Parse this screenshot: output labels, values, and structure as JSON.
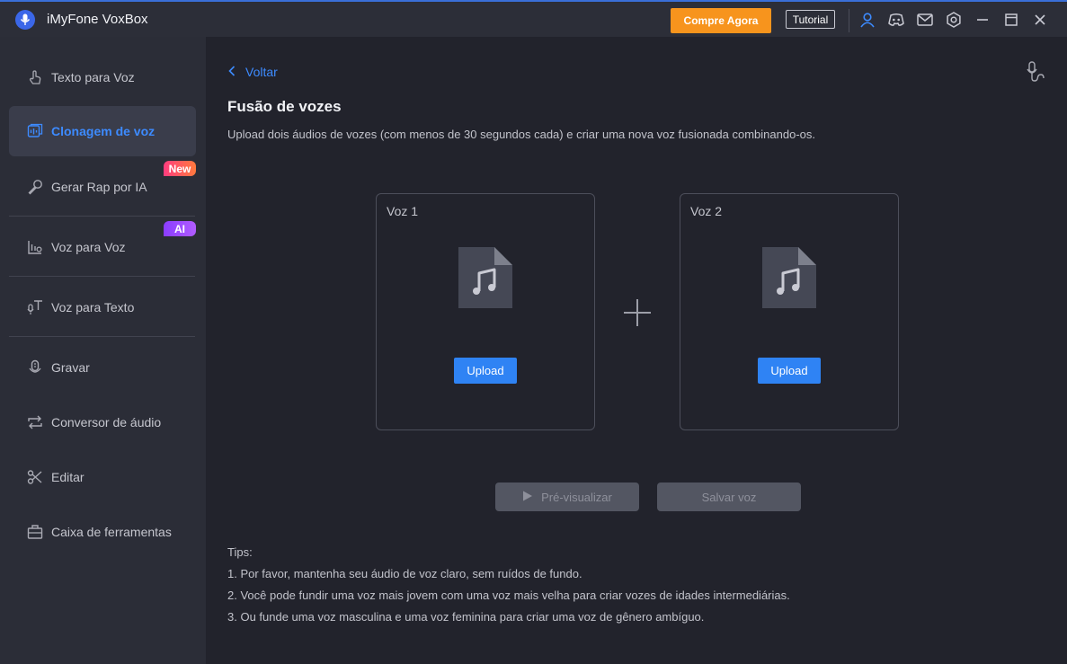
{
  "app": {
    "title": "iMyFone VoxBox"
  },
  "header": {
    "buy_label": "Compre Agora",
    "tutorial_label": "Tutorial",
    "icons": [
      "user-icon",
      "discord-icon",
      "mail-icon",
      "settings-icon",
      "minimize-icon",
      "maximize-icon",
      "close-icon"
    ]
  },
  "sidebar": {
    "items": [
      {
        "label": "Texto para Voz",
        "icon": "hand-tap-icon"
      },
      {
        "label": "Clonagem de voz",
        "icon": "voice-clone-icon",
        "active": true
      },
      {
        "label": "Gerar Rap por IA",
        "icon": "microphone-icon",
        "badge": "New"
      },
      {
        "label": "Voz para Voz",
        "icon": "voice-changer-icon",
        "badge": "AI"
      },
      {
        "label": "Voz para Texto",
        "icon": "speech-to-text-icon"
      },
      {
        "label": "Gravar",
        "icon": "record-icon"
      },
      {
        "label": "Conversor de áudio",
        "icon": "convert-icon"
      },
      {
        "label": "Editar",
        "icon": "scissors-icon"
      },
      {
        "label": "Caixa de ferramentas",
        "icon": "toolbox-icon"
      }
    ]
  },
  "main": {
    "back_label": "Voltar",
    "title": "Fusão de vozes",
    "subtitle": "Upload dois áudios de vozes (com menos de 30 segundos cada) e criar uma nova voz fusionada combinando-os.",
    "voice1": {
      "label": "Voz 1",
      "upload_label": "Upload"
    },
    "voice2": {
      "label": "Voz 2",
      "upload_label": "Upload"
    },
    "preview_label": "Pré-visualizar",
    "save_label": "Salvar voz",
    "tips": {
      "heading": "Tips:",
      "items": [
        "1. Por favor, mantenha seu áudio de voz claro, sem ruídos de fundo.",
        "2. Você pode fundir uma voz mais jovem com uma voz mais velha para criar vozes de idades intermediárias.",
        "3. Ou funde uma voz masculina e uma voz feminina para criar uma voz de gênero ambíguo."
      ]
    }
  },
  "colors": {
    "accent": "#3d8bff",
    "buy": "#f7941d",
    "upload": "#2f83f4"
  }
}
